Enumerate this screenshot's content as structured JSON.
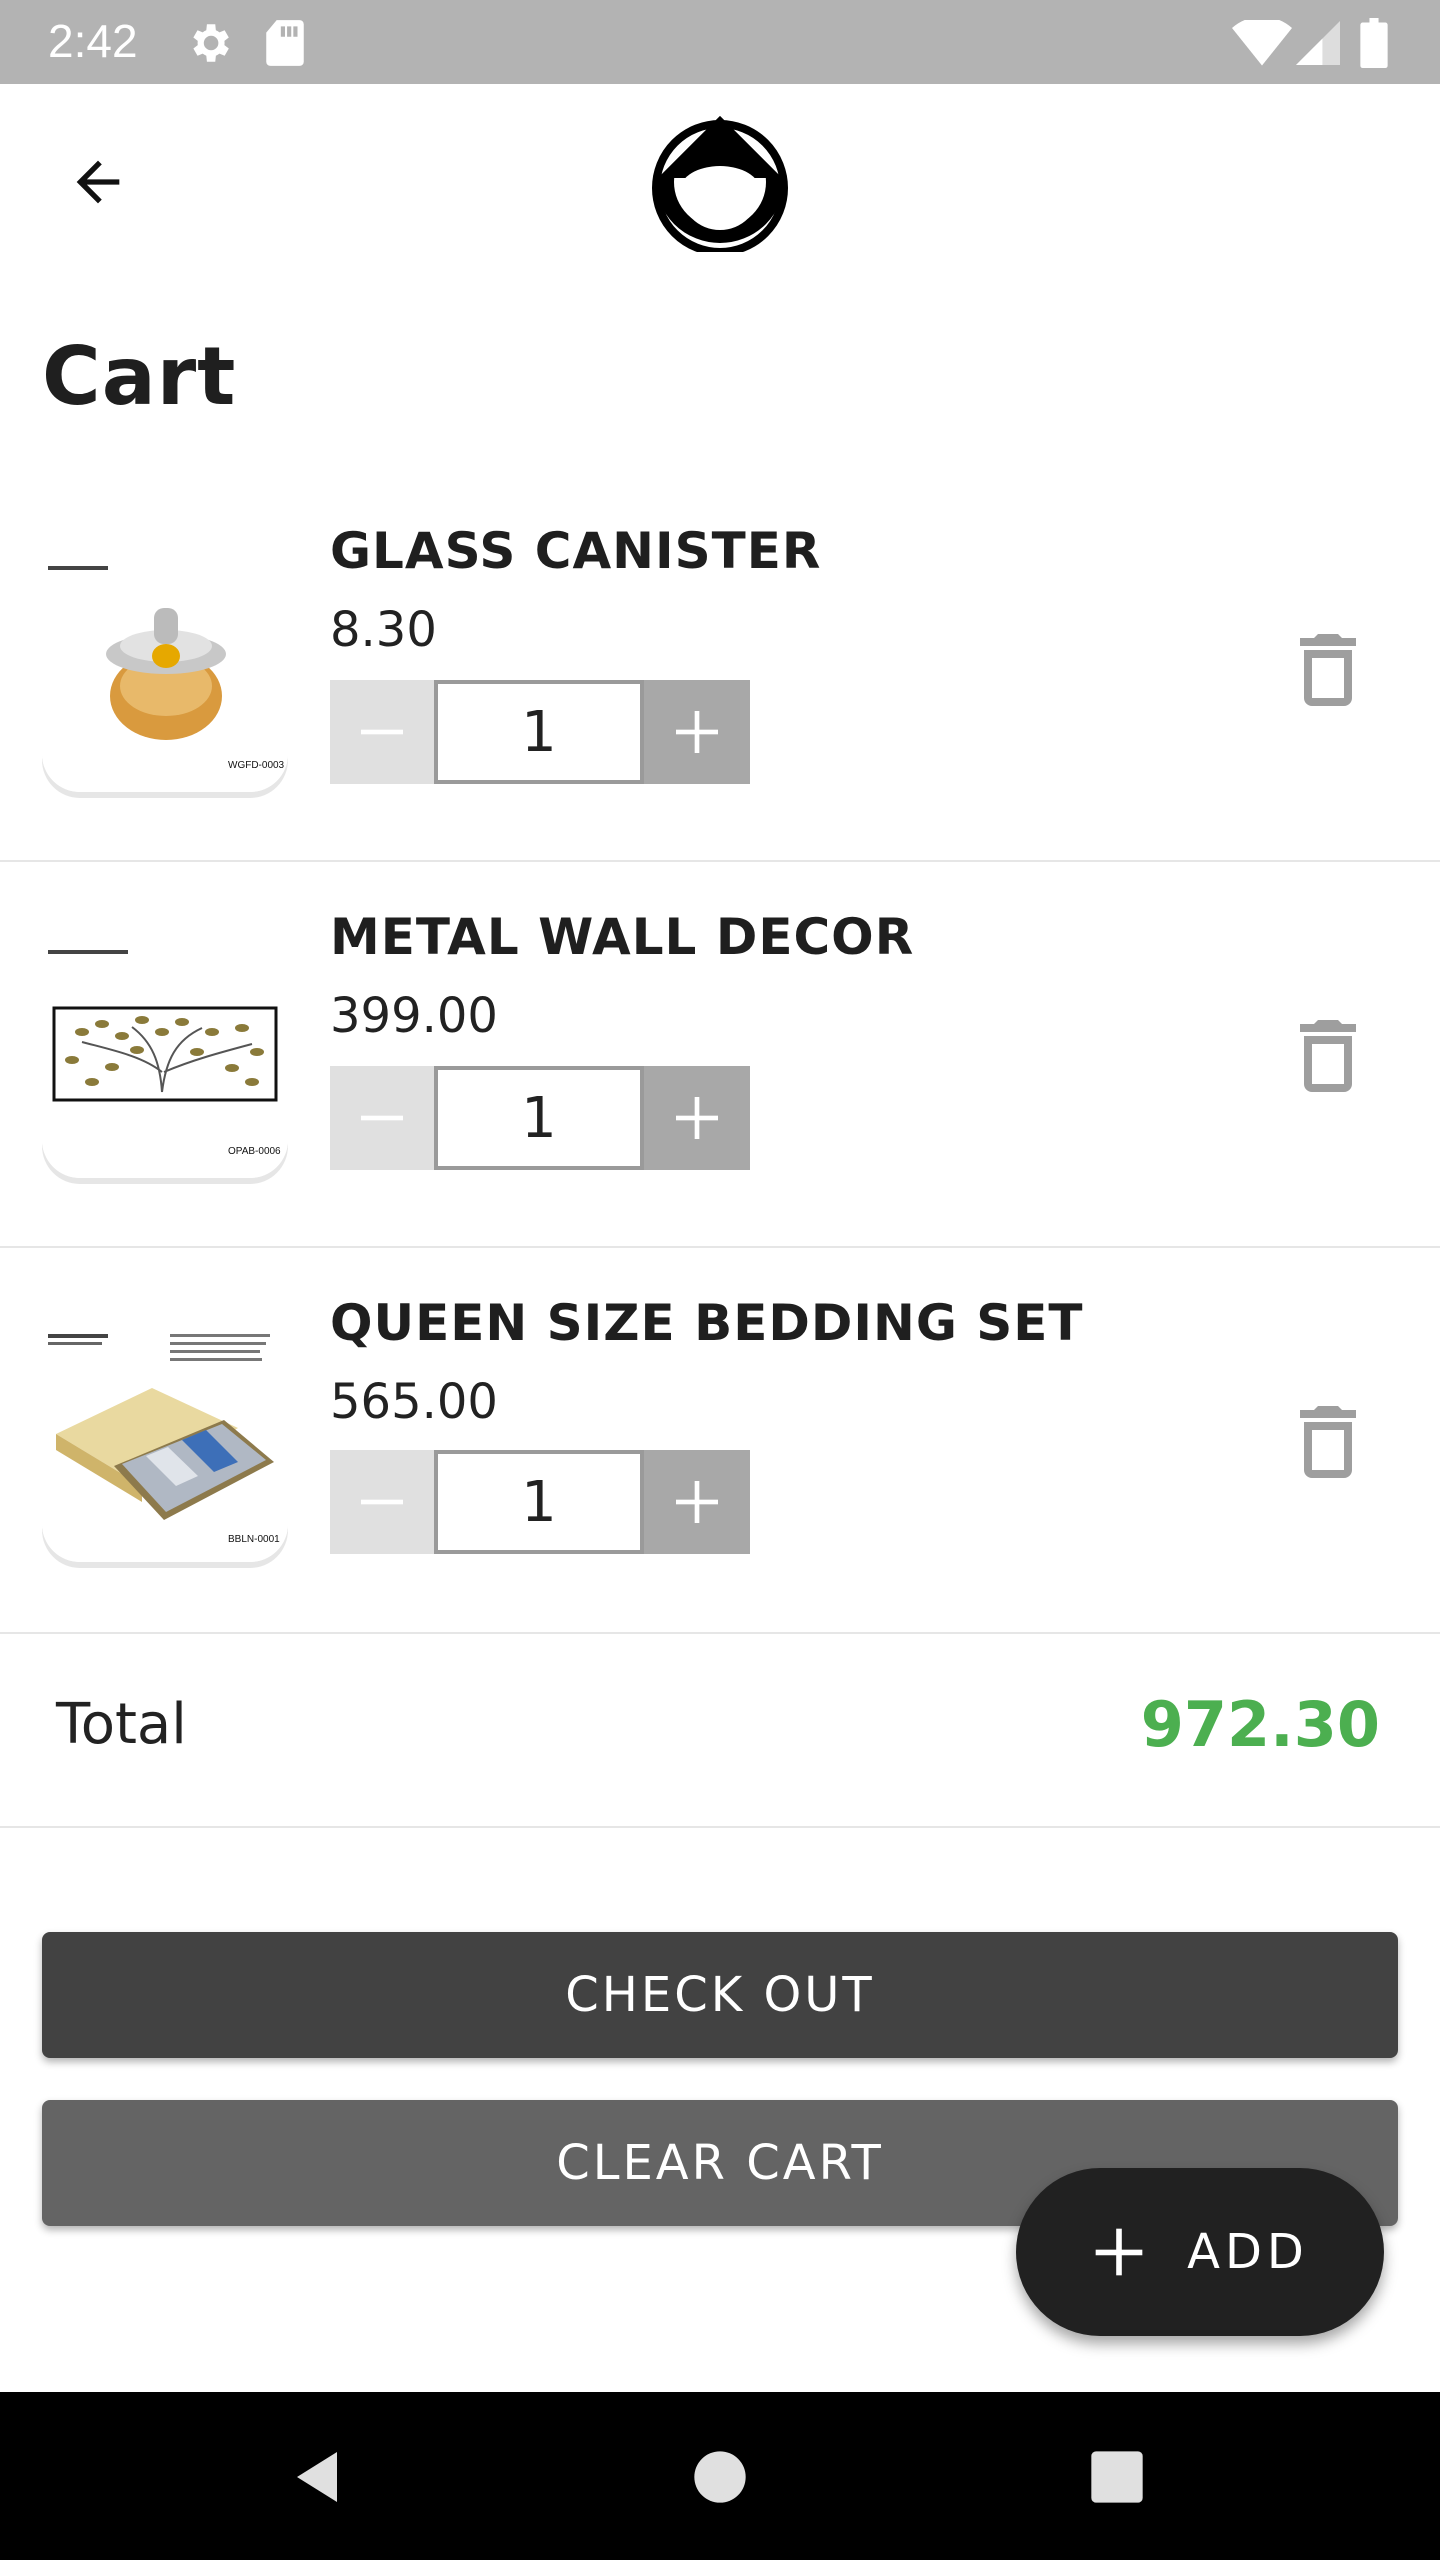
{
  "status_bar": {
    "time": "2:42"
  },
  "page": {
    "title": "Cart"
  },
  "cart": {
    "items": [
      {
        "name": "GLASS CANISTER",
        "price": "8.30",
        "quantity": "1",
        "sku": "WGFD-0003"
      },
      {
        "name": "METAL WALL DECOR",
        "price": "399.00",
        "quantity": "1",
        "sku": "OPAB-0006"
      },
      {
        "name": "QUEEN SIZE BEDDING SET",
        "price": "565.00",
        "quantity": "1",
        "sku": "BBLN-0001"
      }
    ],
    "total_label": "Total",
    "total_value": "972.30"
  },
  "buttons": {
    "checkout": "CHECK OUT",
    "clear_cart": "CLEAR CART",
    "fab_add": "ADD"
  },
  "colors": {
    "total": "#4caf50",
    "checkout_bg": "#424242",
    "clear_bg": "#646464",
    "fab_bg": "#212121"
  }
}
